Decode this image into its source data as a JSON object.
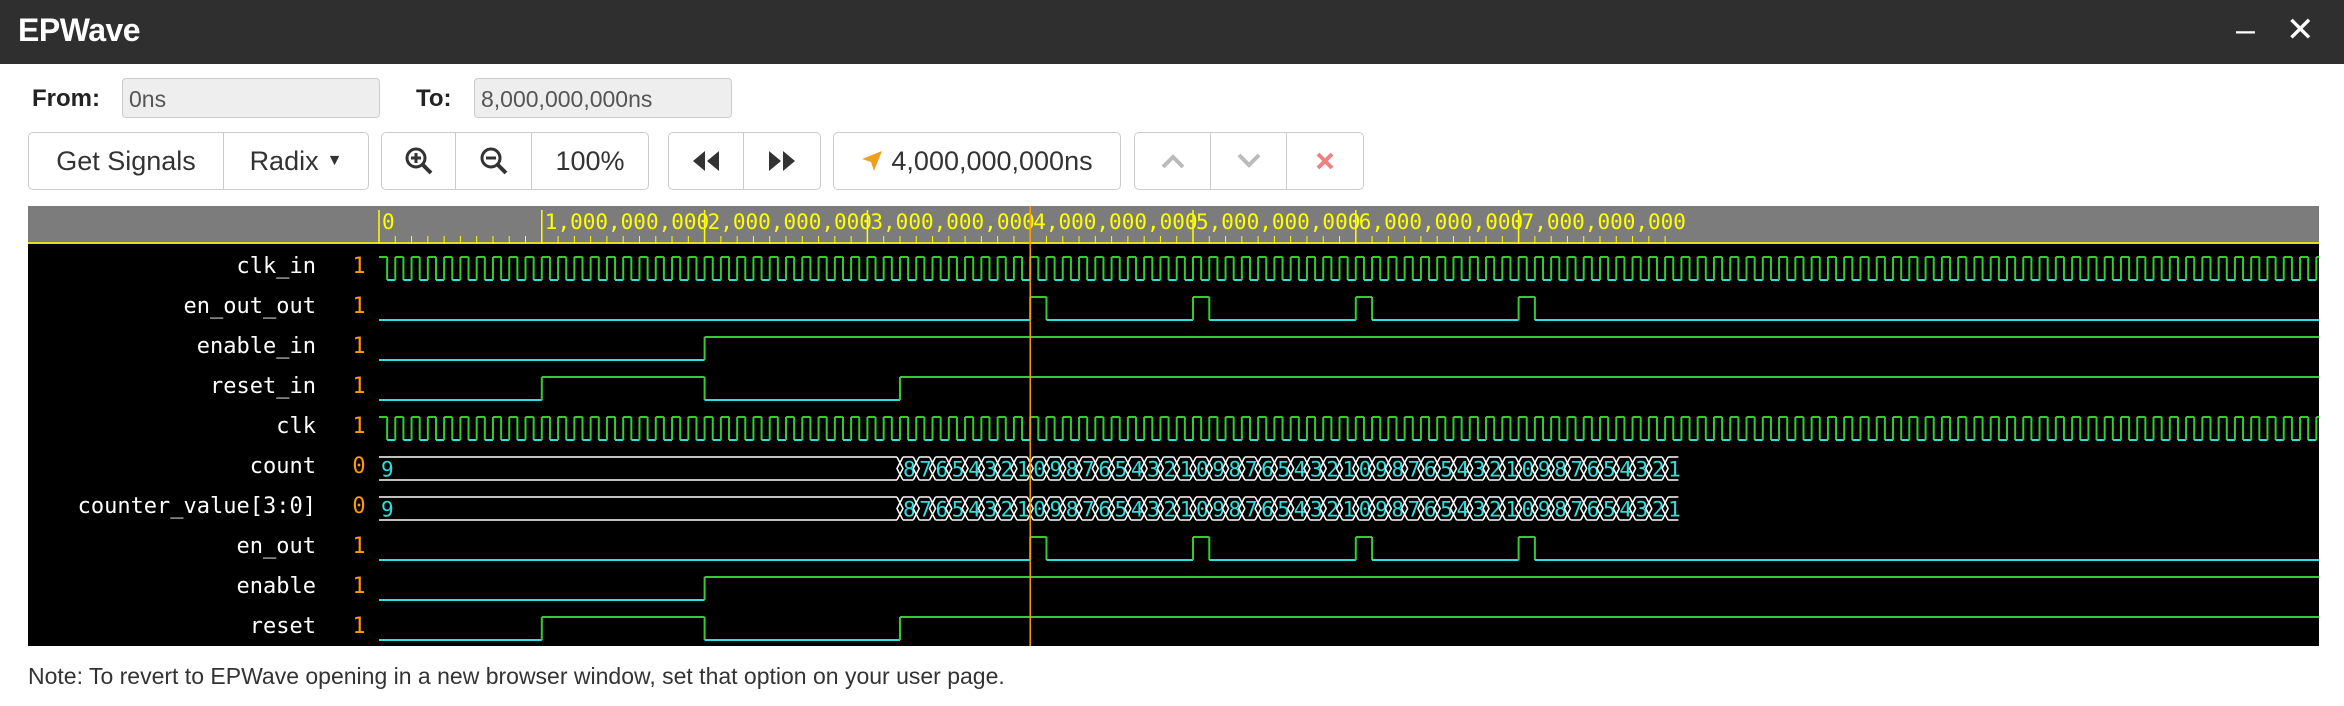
{
  "app": {
    "title": "EPWave"
  },
  "window_controls": {
    "minimize_icon": "minimize-icon",
    "close_icon": "close-icon"
  },
  "range": {
    "from_label": "From:",
    "from_value": "0ns",
    "to_label": "To:",
    "to_value": "8,000,000,000ns"
  },
  "toolbar": {
    "get_signals": "Get Signals",
    "radix": "Radix",
    "zoom_level": "100%",
    "cursor_time": "4,000,000,000ns"
  },
  "ruler": {
    "ticks": [
      "0",
      "1,000,000,000",
      "2,000,000,000",
      "3,000,000,000",
      "4,000,000,000",
      "5,000,000,000",
      "6,000,000,000",
      "7,000,000,000"
    ]
  },
  "signals": [
    {
      "name": "clk_in",
      "value": "1"
    },
    {
      "name": "en_out_out",
      "value": "1"
    },
    {
      "name": "enable_in",
      "value": "1"
    },
    {
      "name": "reset_in",
      "value": "1"
    },
    {
      "name": "clk",
      "value": "1"
    },
    {
      "name": "count",
      "value": "0",
      "initial": "9",
      "sequence": [
        "8",
        "7",
        "6",
        "5",
        "4",
        "3",
        "2",
        "1",
        "0",
        "9",
        "8",
        "7",
        "6",
        "5",
        "4",
        "3",
        "2",
        "1",
        "0",
        "9",
        "8",
        "7",
        "6",
        "5",
        "4",
        "3",
        "2",
        "1",
        "0",
        "9",
        "8",
        "7",
        "6",
        "5",
        "4",
        "3",
        "2",
        "1",
        "0",
        "9",
        "8",
        "7",
        "6",
        "5",
        "4",
        "3",
        "2",
        "1"
      ]
    },
    {
      "name": "counter_value[3:0]",
      "value": "0",
      "initial": "9",
      "sequence": [
        "8",
        "7",
        "6",
        "5",
        "4",
        "3",
        "2",
        "1",
        "0",
        "9",
        "8",
        "7",
        "6",
        "5",
        "4",
        "3",
        "2",
        "1",
        "0",
        "9",
        "8",
        "7",
        "6",
        "5",
        "4",
        "3",
        "2",
        "1",
        "0",
        "9",
        "8",
        "7",
        "6",
        "5",
        "4",
        "3",
        "2",
        "1",
        "0",
        "9",
        "8",
        "7",
        "6",
        "5",
        "4",
        "3",
        "2",
        "1"
      ]
    },
    {
      "name": "en_out",
      "value": "1"
    },
    {
      "name": "enable",
      "value": "1"
    },
    {
      "name": "reset",
      "value": "1"
    }
  ],
  "colors": {
    "wave_high": "#33cc33",
    "wave_low": "#33dddd",
    "ruler_text": "#ffff00",
    "value_text": "#ff9900",
    "cursor": "#ff9900",
    "bus_text": "#33dddd"
  },
  "note": "Note: To revert to EPWave opening in a new browser window, set that option on your user page."
}
